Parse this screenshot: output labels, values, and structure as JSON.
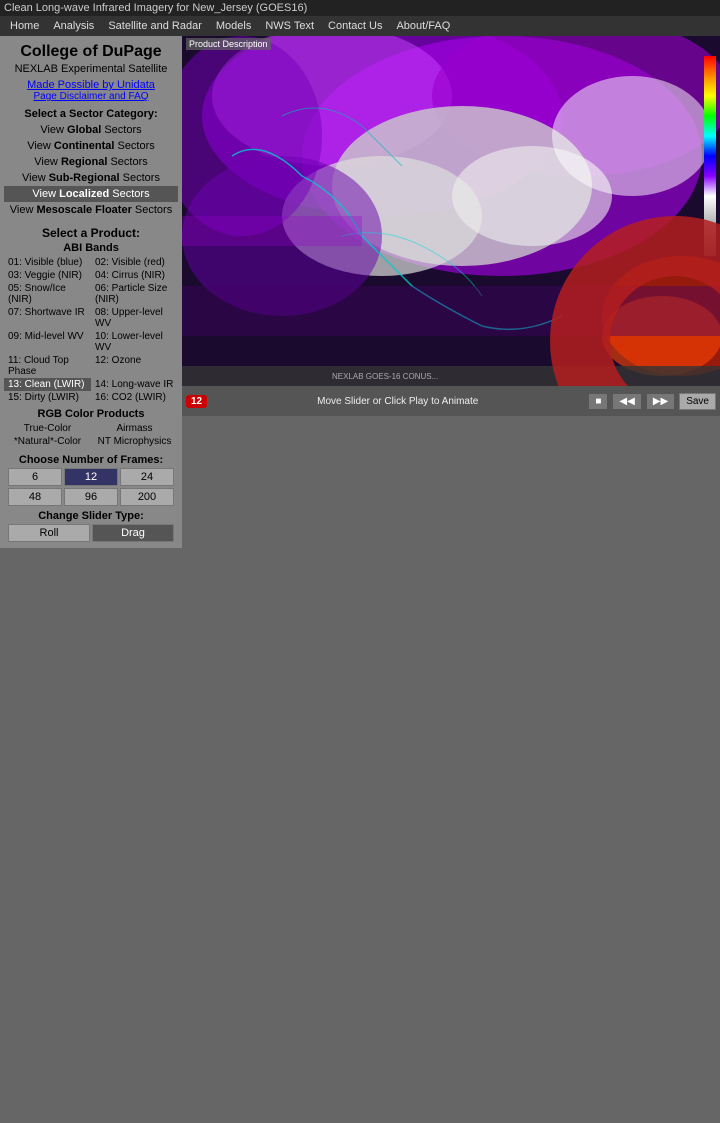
{
  "titleBar": {
    "text": "Clean Long-wave Infrared Imagery for New_Jersey (GOES16)"
  },
  "nav": {
    "items": [
      "Home",
      "Analysis",
      "Satellite and Radar",
      "Models",
      "NWS Text",
      "Contact Us",
      "About/FAQ"
    ]
  },
  "sidebar": {
    "collegeName": "College of DuPage",
    "nexlab": "NEXLAB Experimental Satellite",
    "unidataLink": "Made Possible by Unidata",
    "disclaimerLink": "Page Disclaimer and FAQ",
    "sectorHeader": "Select a Sector Category:",
    "sectors": [
      {
        "prefix": "View ",
        "bold": "Global",
        "suffix": " Sectors"
      },
      {
        "prefix": "View ",
        "bold": "Continental",
        "suffix": " Sectors"
      },
      {
        "prefix": "View ",
        "bold": "Regional",
        "suffix": " Sectors"
      },
      {
        "prefix": "View ",
        "bold": "Sub-Regional",
        "suffix": " Sectors"
      },
      {
        "prefix": "View ",
        "bold": "Localized",
        "suffix": " Sectors",
        "active": true
      },
      {
        "prefix": "View ",
        "bold": "Mesoscale Floater",
        "suffix": " Sectors"
      }
    ],
    "productHeader": "Select a Product:",
    "abiHeader": "ABI Bands",
    "bands": [
      {
        "id": "01",
        "label": "01: Visible (blue)",
        "col": 0
      },
      {
        "id": "02",
        "label": "02: Visible (red)",
        "col": 1
      },
      {
        "id": "03",
        "label": "03: Veggie (NIR)",
        "col": 0
      },
      {
        "id": "04",
        "label": "04: Cirrus (NIR)",
        "col": 1
      },
      {
        "id": "05",
        "label": "05: Snow/Ice (NIR)",
        "col": 0
      },
      {
        "id": "06",
        "label": "06: Particle Size (NIR)",
        "col": 1
      },
      {
        "id": "07",
        "label": "07: Shortwave IR",
        "col": 0
      },
      {
        "id": "08",
        "label": "08: Upper-level WV",
        "col": 1
      },
      {
        "id": "09",
        "label": "09: Mid-level WV",
        "col": 0
      },
      {
        "id": "10",
        "label": "10: Lower-level WV",
        "col": 1
      },
      {
        "id": "11",
        "label": "11: Cloud Top Phase",
        "col": 0
      },
      {
        "id": "12",
        "label": "12: Ozone",
        "col": 1
      },
      {
        "id": "13",
        "label": "13: Clean (LWIR)",
        "col": 0,
        "selected": true
      },
      {
        "id": "14",
        "label": "14: Long-wave IR",
        "col": 1
      },
      {
        "id": "15",
        "label": "15: Dirty (LWIR)",
        "col": 0
      },
      {
        "id": "16",
        "label": "16: CO2 (LWIR)",
        "col": 1
      }
    ],
    "rgbHeader": "RGB Color Products",
    "rgbProducts": [
      {
        "label": "True-Color",
        "col": 0
      },
      {
        "label": "Airmass",
        "col": 1
      },
      {
        "label": "*Natural*-Color",
        "col": 0
      },
      {
        "label": "NT Microphysics",
        "col": 1
      }
    ],
    "framesHeader": "Choose Number of Frames:",
    "frameOptions": [
      "6",
      "12",
      "24",
      "48",
      "96",
      "200"
    ],
    "selectedFrame": "12",
    "sliderHeader": "Change Slider Type:",
    "sliderOptions": [
      "Roll",
      "Drag"
    ],
    "selectedSlider": "Drag"
  },
  "controls": {
    "sliderText": "Move Slider or Click Play to Animate",
    "frameCount": "12",
    "saveLabel": "Save"
  },
  "imageArea": {
    "productDesc": "Product Description"
  }
}
